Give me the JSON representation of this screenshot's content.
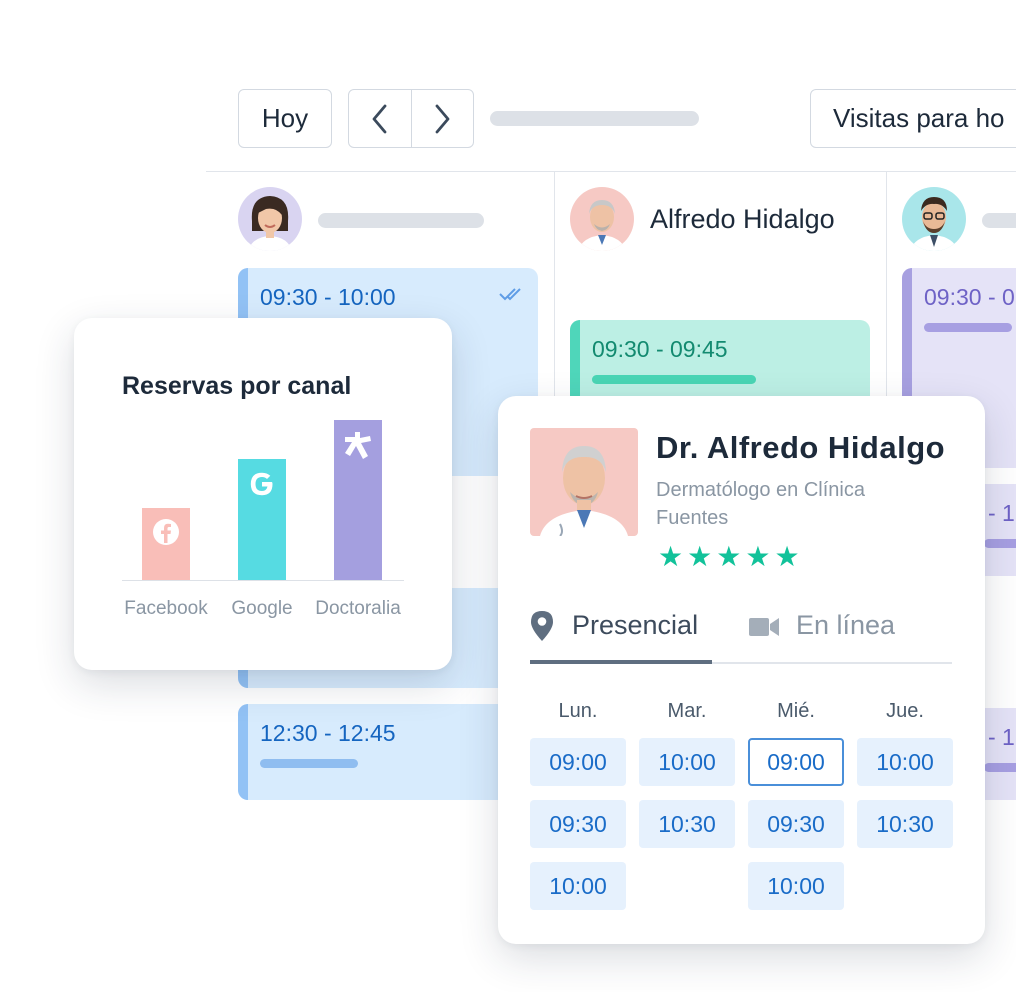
{
  "toolbar": {
    "today_label": "Hoy",
    "visits_label": "Visitas para ho"
  },
  "calendar": {
    "columns": [
      {
        "doctor_name": ""
      },
      {
        "doctor_name": "Alfredo Hidalgo"
      },
      {
        "doctor_name": ""
      }
    ],
    "slots": {
      "c1_s1": "09:30 - 10:00",
      "c1_s4": "12:30 - 12:45",
      "c2_s1": "09:30 - 09:45",
      "c3_s1": "09:30 - 0",
      "c3_s2": "- 1",
      "c3_s3": "- 1"
    }
  },
  "chart_card": {
    "title": "Reservas por canal"
  },
  "chart_data": {
    "type": "bar",
    "title": "Reservas por canal",
    "categories": [
      "Facebook",
      "Google",
      "Doctoralia"
    ],
    "values": [
      72,
      120,
      159
    ],
    "colors": [
      "#f9beb8",
      "#56dbe2",
      "#a49fdf"
    ],
    "icons": [
      "facebook-icon",
      "google-icon",
      "doctoralia-icon"
    ],
    "xlabel": "",
    "ylabel": "",
    "grid": false,
    "legend": "none"
  },
  "profile_card": {
    "name": "Dr. Alfredo Hidalgo",
    "specialty": "Dermatólogo en Clínica Fuentes",
    "rating": 5,
    "star": "★",
    "tabs": [
      {
        "label": "Presencial",
        "icon": "location-pin-icon",
        "active": true
      },
      {
        "label": "En línea",
        "icon": "video-camera-icon",
        "active": false
      }
    ],
    "days": [
      {
        "label": "Lun.",
        "times": [
          "09:00",
          "09:30",
          "10:00"
        ]
      },
      {
        "label": "Mar.",
        "times": [
          "10:00",
          "10:30"
        ]
      },
      {
        "label": "Mié.",
        "times": [
          "09:00",
          "09:30",
          "10:00"
        ]
      },
      {
        "label": "Jue.",
        "times": [
          "10:00",
          "10:30"
        ]
      }
    ],
    "selected": {
      "day": "Mié.",
      "time": "09:00"
    },
    "colors": {
      "accent": "#12c29a",
      "time_text": "#1a6cc8",
      "time_bg": "#e6f1fd"
    }
  }
}
